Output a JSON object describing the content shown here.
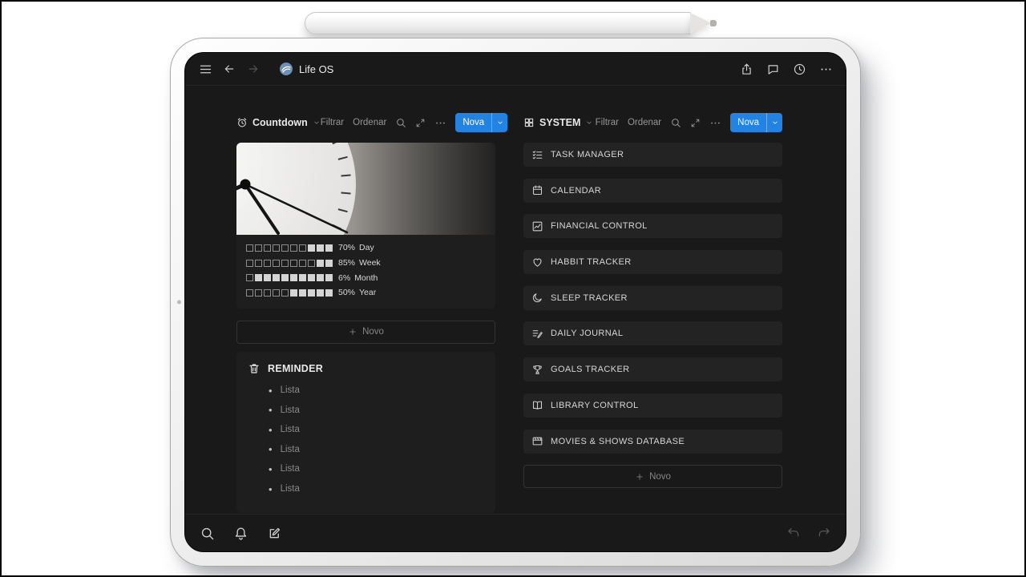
{
  "topbar": {
    "title": "Life OS"
  },
  "left_db": {
    "view_name": "Countdown",
    "filter_label": "Filtrar",
    "sort_label": "Ordenar",
    "new_button_label": "Nova",
    "progress_rows": [
      {
        "percent": "70%",
        "label": "Day",
        "filled": 7,
        "total": 10
      },
      {
        "percent": "85%",
        "label": "Week",
        "filled": 8,
        "total": 10
      },
      {
        "percent": "6%",
        "label": "Month",
        "filled": 1,
        "total": 10
      },
      {
        "percent": "50%",
        "label": "Year",
        "filled": 5,
        "total": 10
      }
    ],
    "new_row_label": "Novo",
    "reminder": {
      "title": "REMINDER",
      "items": [
        "Lista",
        "Lista",
        "Lista",
        "Lista",
        "Lista",
        "Lista"
      ]
    }
  },
  "right_db": {
    "view_name": "SYSTEM",
    "filter_label": "Filtrar",
    "sort_label": "Ordenar",
    "new_button_label": "Nova",
    "cards": [
      {
        "icon": "task-manager-icon",
        "label": "TASK MANAGER"
      },
      {
        "icon": "calendar-icon",
        "label": "CALENDAR"
      },
      {
        "icon": "financial-control-icon",
        "label": "FINANCIAL CONTROL"
      },
      {
        "icon": "habit-tracker-icon",
        "label": "HABBIT TRACKER"
      },
      {
        "icon": "sleep-tracker-icon",
        "label": "SLEEP TRACKER"
      },
      {
        "icon": "daily-journal-icon",
        "label": "DAILY JOURNAL"
      },
      {
        "icon": "goals-tracker-icon",
        "label": "GOALS TRACKER"
      },
      {
        "icon": "library-control-icon",
        "label": "LIBRARY CONTROL"
      },
      {
        "icon": "movies-shows-icon",
        "label": "MOVIES & SHOWS DATABASE"
      }
    ],
    "new_row_label": "Novo"
  },
  "colors": {
    "accent": "#2383e2",
    "screen_bg": "#191919",
    "card_bg": "#232323"
  }
}
